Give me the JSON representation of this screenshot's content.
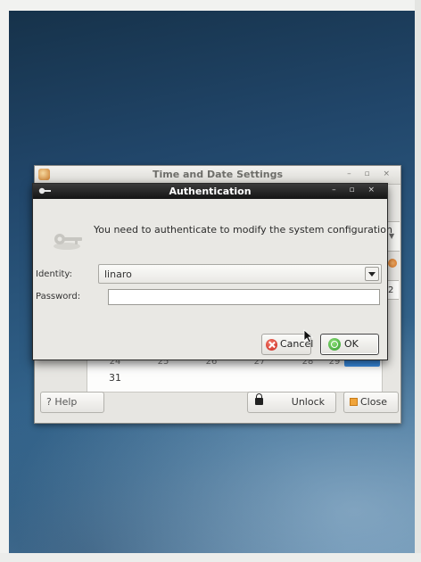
{
  "background_window": {
    "title": "Time and Date Settings",
    "window_controls": "– ▫ ×",
    "partial_field_value": "2",
    "calendar": {
      "faded_row": [
        "24",
        "25",
        "26",
        "27",
        "28",
        "29"
      ],
      "last_day": "31"
    },
    "buttons": {
      "help": "? Help",
      "unlock": "Unlock",
      "close": "Close"
    }
  },
  "auth_dialog": {
    "title": "Authentication",
    "window_controls": "– ▫ ×",
    "message": "You need to authenticate to modify the system configuration",
    "identity_label": "Identity:",
    "identity_value": "linaro",
    "password_label": "Password:",
    "password_value": "",
    "cancel_label": "Cancel",
    "ok_label": "OK"
  },
  "colors": {
    "accent_selection": "#3a8ee6",
    "dialog_titlebar": "#151515",
    "desktop": "#2d5b82"
  }
}
